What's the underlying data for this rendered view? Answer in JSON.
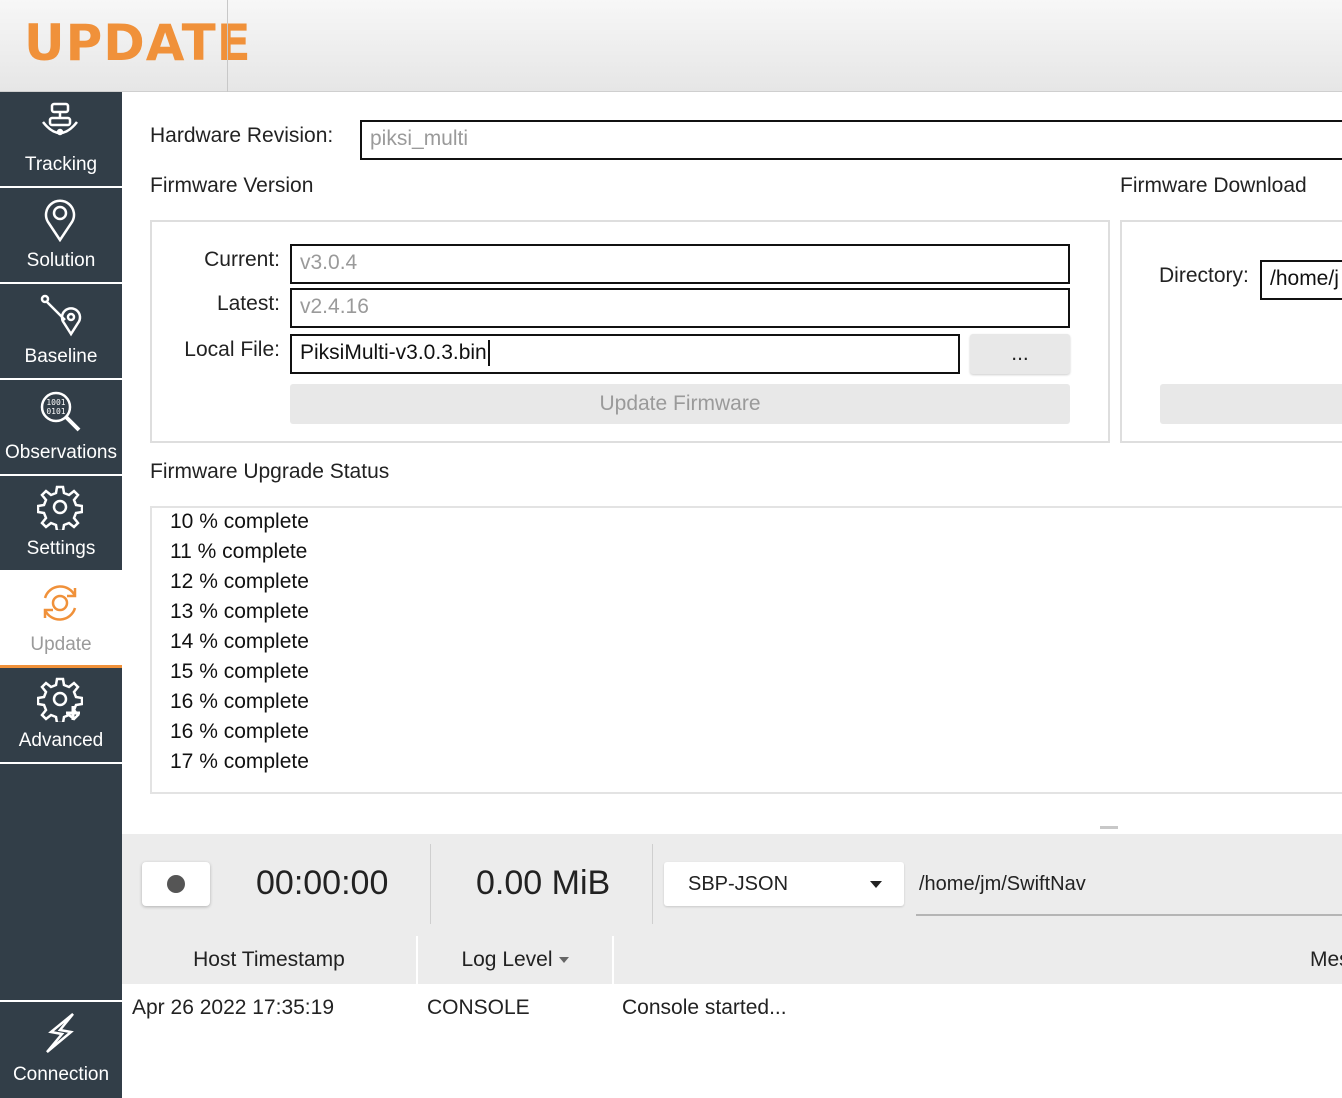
{
  "header": {
    "title": "UPDATE"
  },
  "sidebar": {
    "items": [
      {
        "label": "Tracking",
        "icon": "satellite-dish-icon",
        "active": false
      },
      {
        "label": "Solution",
        "icon": "location-pin-icon",
        "active": false
      },
      {
        "label": "Baseline",
        "icon": "baseline-icon",
        "active": false
      },
      {
        "label": "Observations",
        "icon": "observations-magnifier-icon",
        "active": false
      },
      {
        "label": "Settings",
        "icon": "gear-icon",
        "active": false
      },
      {
        "label": "Update",
        "icon": "update-refresh-icon",
        "active": true
      },
      {
        "label": "Advanced",
        "icon": "gear-plus-icon",
        "active": false
      }
    ],
    "connection": {
      "label": "Connection",
      "icon": "lightning-icon"
    }
  },
  "hardware": {
    "label": "Hardware Revision:",
    "value": "piksi_multi"
  },
  "firmware_version": {
    "section_title": "Firmware Version",
    "current_label": "Current:",
    "current_value": "v3.0.4",
    "latest_label": "Latest:",
    "latest_value": "v2.4.16",
    "local_file_label": "Local File:",
    "local_file_value": "PiksiMulti-v3.0.3.bin",
    "browse_label": "...",
    "update_button": "Update Firmware"
  },
  "firmware_download": {
    "section_title": "Firmware Download",
    "directory_label": "Directory:",
    "directory_value": "/home/j"
  },
  "upgrade_status": {
    "title": "Firmware Upgrade Status",
    "lines": [
      "10 % complete",
      "11 % complete",
      "12 % complete",
      "13 % complete",
      "14 % complete",
      "15 % complete",
      "16 % complete",
      "16 % complete",
      "17 % complete"
    ]
  },
  "recorder": {
    "elapsed": "00:00:00",
    "size": "0.00 MiB",
    "format": "SBP-JSON",
    "path": "/home/jm/SwiftNav"
  },
  "log": {
    "columns": [
      "Host Timestamp",
      "Log Level",
      "Mes"
    ],
    "rows": [
      {
        "timestamp": "Apr 26 2022 17:35:19",
        "level": "CONSOLE",
        "message": "Console started..."
      }
    ]
  },
  "colors": {
    "accent": "#f0913a",
    "sidebar": "#323e48"
  }
}
